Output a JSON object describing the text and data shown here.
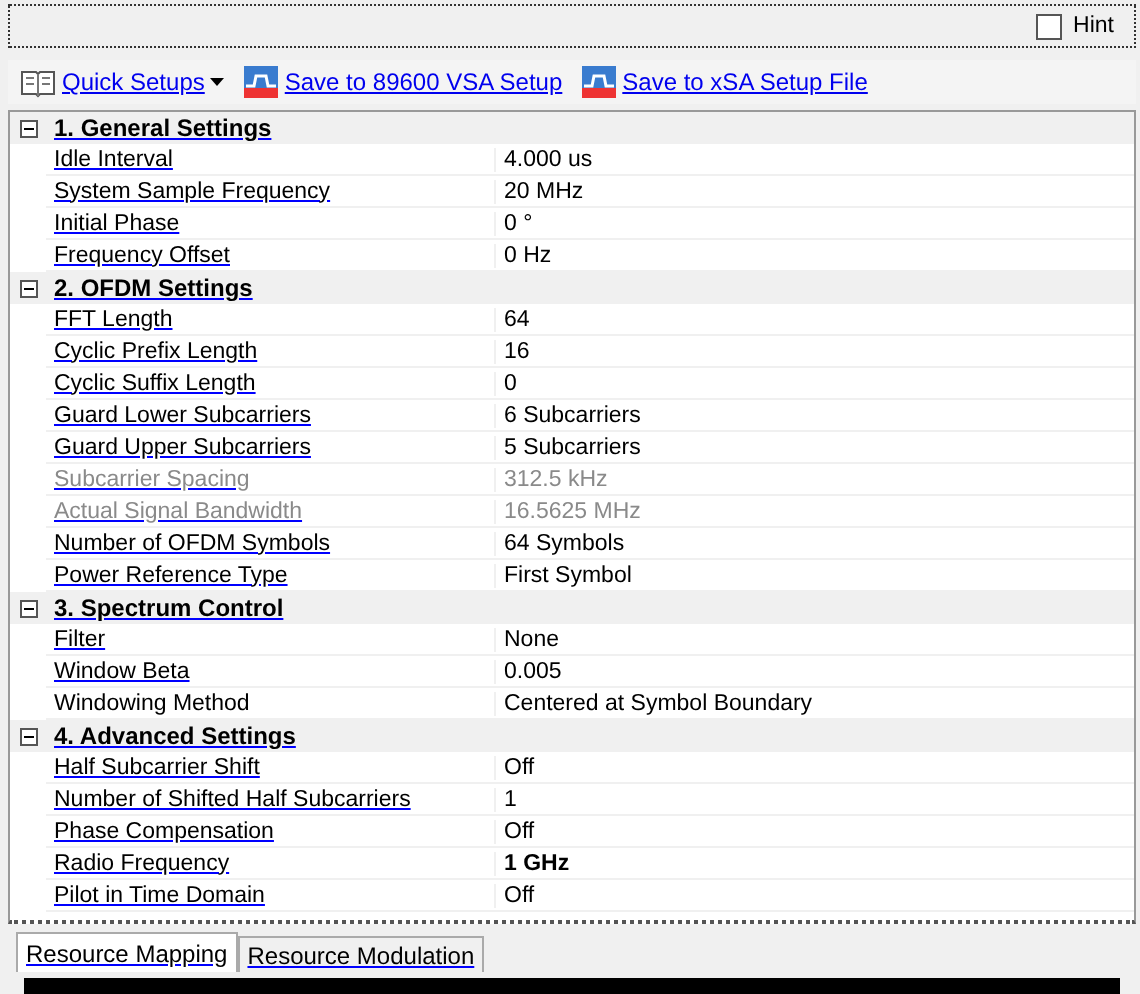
{
  "hint": {
    "label": "Hint",
    "checked": false
  },
  "toolbar": [
    {
      "kind": "menu",
      "label": "Quick Setups"
    },
    {
      "kind": "save",
      "label": "Save to 89600 VSA Setup"
    },
    {
      "kind": "save",
      "label": "Save to xSA Setup File"
    }
  ],
  "categories": [
    {
      "title": "1. General Settings",
      "expanded": true,
      "properties": [
        {
          "name": "Idle Interval",
          "value": "4.000 us",
          "linked": true,
          "disabled": false,
          "bold": false
        },
        {
          "name": "System Sample Frequency",
          "value": "20 MHz",
          "linked": true,
          "disabled": false,
          "bold": false
        },
        {
          "name": "Initial Phase",
          "value": "0 °",
          "linked": true,
          "disabled": false,
          "bold": false
        },
        {
          "name": "Frequency Offset",
          "value": "0 Hz",
          "linked": true,
          "disabled": false,
          "bold": false
        }
      ]
    },
    {
      "title": "2. OFDM Settings",
      "expanded": true,
      "properties": [
        {
          "name": "FFT Length",
          "value": "64",
          "linked": true,
          "disabled": false,
          "bold": false
        },
        {
          "name": "Cyclic Prefix Length",
          "value": "16",
          "linked": true,
          "disabled": false,
          "bold": false
        },
        {
          "name": "Cyclic Suffix Length",
          "value": "0",
          "linked": true,
          "disabled": false,
          "bold": false
        },
        {
          "name": "Guard Lower Subcarriers",
          "value": "6 Subcarriers",
          "linked": true,
          "disabled": false,
          "bold": false
        },
        {
          "name": "Guard Upper Subcarriers",
          "value": "5 Subcarriers",
          "linked": true,
          "disabled": false,
          "bold": false
        },
        {
          "name": "Subcarrier Spacing",
          "value": "312.5 kHz",
          "linked": true,
          "disabled": true,
          "bold": false
        },
        {
          "name": "Actual Signal Bandwidth",
          "value": "16.5625 MHz",
          "linked": true,
          "disabled": true,
          "bold": false
        },
        {
          "name": "Number of OFDM Symbols",
          "value": "64 Symbols",
          "linked": true,
          "disabled": false,
          "bold": false
        },
        {
          "name": "Power Reference Type",
          "value": "First Symbol",
          "linked": true,
          "disabled": false,
          "bold": false
        }
      ]
    },
    {
      "title": "3. Spectrum Control",
      "expanded": true,
      "properties": [
        {
          "name": "Filter",
          "value": "None",
          "linked": true,
          "disabled": false,
          "bold": false
        },
        {
          "name": "Window Beta",
          "value": "0.005",
          "linked": true,
          "disabled": false,
          "bold": false
        },
        {
          "name": "Windowing Method",
          "value": "Centered at Symbol Boundary",
          "linked": false,
          "disabled": false,
          "bold": false
        }
      ]
    },
    {
      "title": "4. Advanced Settings",
      "expanded": true,
      "properties": [
        {
          "name": "Half Subcarrier Shift",
          "value": "Off",
          "linked": true,
          "disabled": false,
          "bold": false
        },
        {
          "name": "Number of Shifted Half Subcarriers",
          "value": "1",
          "linked": true,
          "disabled": false,
          "bold": false
        },
        {
          "name": "Phase Compensation",
          "value": "Off",
          "linked": true,
          "disabled": false,
          "bold": false
        },
        {
          "name": "Radio Frequency",
          "value": "1 GHz",
          "linked": true,
          "disabled": false,
          "bold": true
        },
        {
          "name": "Pilot in Time Domain",
          "value": "Off",
          "linked": true,
          "disabled": false,
          "bold": false
        }
      ]
    }
  ],
  "tabs": [
    {
      "label": "Resource Mapping",
      "selected": true
    },
    {
      "label": "Resource Modulation",
      "selected": false
    }
  ]
}
